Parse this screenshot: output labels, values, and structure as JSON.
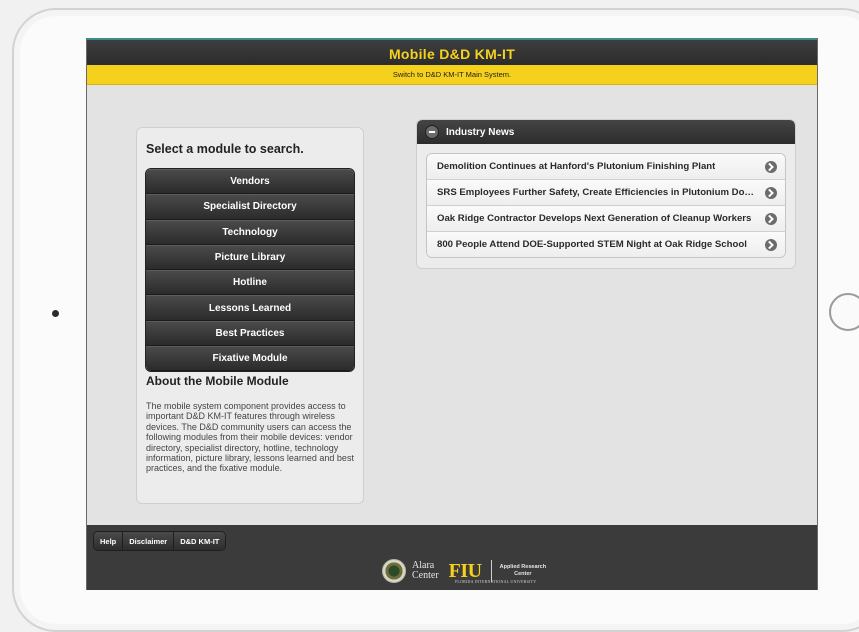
{
  "app": {
    "title": "Mobile D&D KM-IT",
    "switch_link": "Switch to D&D KM-IT Main System."
  },
  "modules": {
    "heading": "Select a module to search.",
    "items": [
      {
        "label": "Vendors"
      },
      {
        "label": "Specialist Directory"
      },
      {
        "label": "Technology"
      },
      {
        "label": "Picture Library"
      },
      {
        "label": "Hotline"
      },
      {
        "label": "Lessons Learned"
      },
      {
        "label": "Best Practices"
      },
      {
        "label": "Fixative Module"
      }
    ]
  },
  "about": {
    "title": "About the Mobile Module",
    "text": "The mobile system component provides access to important D&D KM-IT features through wireless devices. The D&D community users can access the following modules from their mobile devices: vendor directory, specialist directory, hotline, technology information, picture library, lessons learned and best practices, and the fixative module."
  },
  "news": {
    "header": "Industry News",
    "items": [
      {
        "title": "Demolition Continues at Hanford's Plutonium Finishing Plant"
      },
      {
        "title": "SRS Employees Further Safety, Create Efficiencies in Plutonium Do…"
      },
      {
        "title": "Oak Ridge Contractor Develops Next Generation of Cleanup Workers"
      },
      {
        "title": "800 People Attend DOE-Supported STEM Night at Oak Ridge School"
      }
    ]
  },
  "footer": {
    "nav": [
      {
        "label": "Help"
      },
      {
        "label": "Disclaimer"
      },
      {
        "label": "D&D KM-IT"
      }
    ],
    "alara_line1": "Alara",
    "alara_line2": "Center",
    "fiu_logo": "FIU",
    "fiu_subtitle": "FLORIDA INTERNATIONAL UNIVERSITY",
    "arc_line1": "Applied Research",
    "arc_line2": "Center"
  },
  "colors": {
    "accent_yellow": "#f5d01c",
    "bar_dark": "#2b2b2b"
  }
}
